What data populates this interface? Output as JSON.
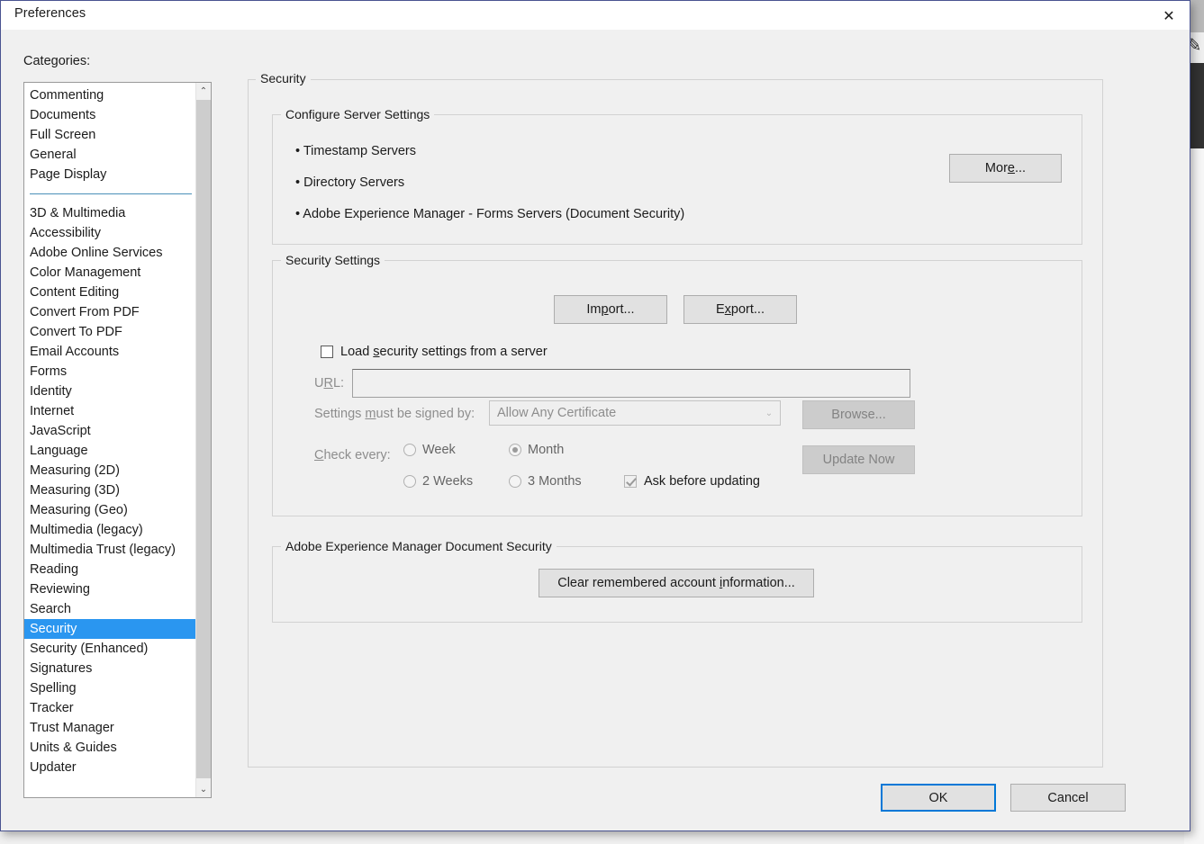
{
  "window": {
    "title": "Preferences",
    "close_icon": "close-icon",
    "close_glyph": "✕"
  },
  "sidebar": {
    "label": "Categories:",
    "selected": "Security",
    "scroll": {
      "up_glyph": "⌃",
      "down_glyph": "⌄"
    },
    "group_one": [
      "Commenting",
      "Documents",
      "Full Screen",
      "General",
      "Page Display"
    ],
    "group_two": [
      "3D & Multimedia",
      "Accessibility",
      "Adobe Online Services",
      "Color Management",
      "Content Editing",
      "Convert From PDF",
      "Convert To PDF",
      "Email Accounts",
      "Forms",
      "Identity",
      "Internet",
      "JavaScript",
      "Language",
      "Measuring (2D)",
      "Measuring (3D)",
      "Measuring (Geo)",
      "Multimedia (legacy)",
      "Multimedia Trust (legacy)",
      "Reading",
      "Reviewing",
      "Search",
      "Security",
      "Security (Enhanced)",
      "Signatures",
      "Spelling",
      "Tracker",
      "Trust Manager",
      "Units & Guides",
      "Updater"
    ]
  },
  "panel": {
    "title": "Security",
    "server_group": {
      "title": "Configure Server Settings",
      "bullets": [
        "• Timestamp Servers",
        "• Directory Servers",
        "• Adobe Experience Manager - Forms Servers (Document Security)"
      ],
      "more_button": "More..."
    },
    "security_settings": {
      "title": "Security Settings",
      "import_button": "Import...",
      "export_button": "Export...",
      "load_checkbox_label": "Load security settings from a server",
      "load_checkbox_checked": false,
      "url_label": "URL:",
      "url_value": "",
      "url_enabled": false,
      "signed_by_label": "Settings must be signed by:",
      "signed_by_value": "Allow Any Certificate",
      "signed_by_arrow": "⌄",
      "browse_button": "Browse...",
      "check_every_label": "Check every:",
      "radio_options": [
        {
          "label": "Week",
          "selected": false
        },
        {
          "label": "2 Weeks",
          "selected": false
        },
        {
          "label": "Month",
          "selected": true
        },
        {
          "label": "3 Months",
          "selected": false
        }
      ],
      "update_now_button": "Update Now",
      "ask_before_label": "Ask before updating",
      "ask_before_checked": true
    },
    "aem_group": {
      "title": "Adobe Experience Manager Document Security",
      "clear_button": "Clear remembered account information..."
    }
  },
  "footer": {
    "ok_label": "OK",
    "cancel_label": "Cancel"
  },
  "colors": {
    "accent": "#0078d7",
    "selection": "#2a96f0",
    "dialog_border": "#4a5491",
    "dialog_bg": "#f0f0f0"
  }
}
